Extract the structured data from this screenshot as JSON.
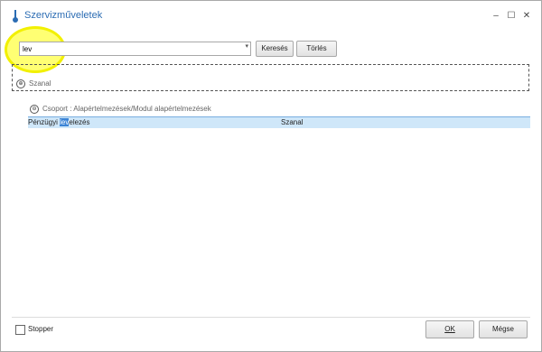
{
  "window": {
    "title": "Szervizműveletek",
    "minimize": "–",
    "maximize": "☐",
    "close": "✕"
  },
  "search": {
    "value": "lev",
    "dropdown_arrow": "▾"
  },
  "buttons": {
    "search": "Keresés",
    "clear": "Törlés",
    "ok": "OK",
    "cancel": "Mégse"
  },
  "top_group": {
    "label": "Szanal",
    "icon": "⊕"
  },
  "grid": {
    "group_header": "Csoport : Alapértelmezések/Modul alapértelmezések",
    "group_icon": "⊖",
    "rows": [
      {
        "name_prefix": "Pénzügyi ",
        "name_highlight": "lev",
        "name_suffix": "elezés",
        "module": "Szanal"
      }
    ]
  },
  "footer": {
    "stopper_label": "Stopper",
    "stopper_checked": false
  },
  "colors": {
    "title": "#2b6cb3",
    "selected_row": "#cfe7f9",
    "text_highlight": "#3b84d6",
    "annotation": "#f2f000"
  }
}
